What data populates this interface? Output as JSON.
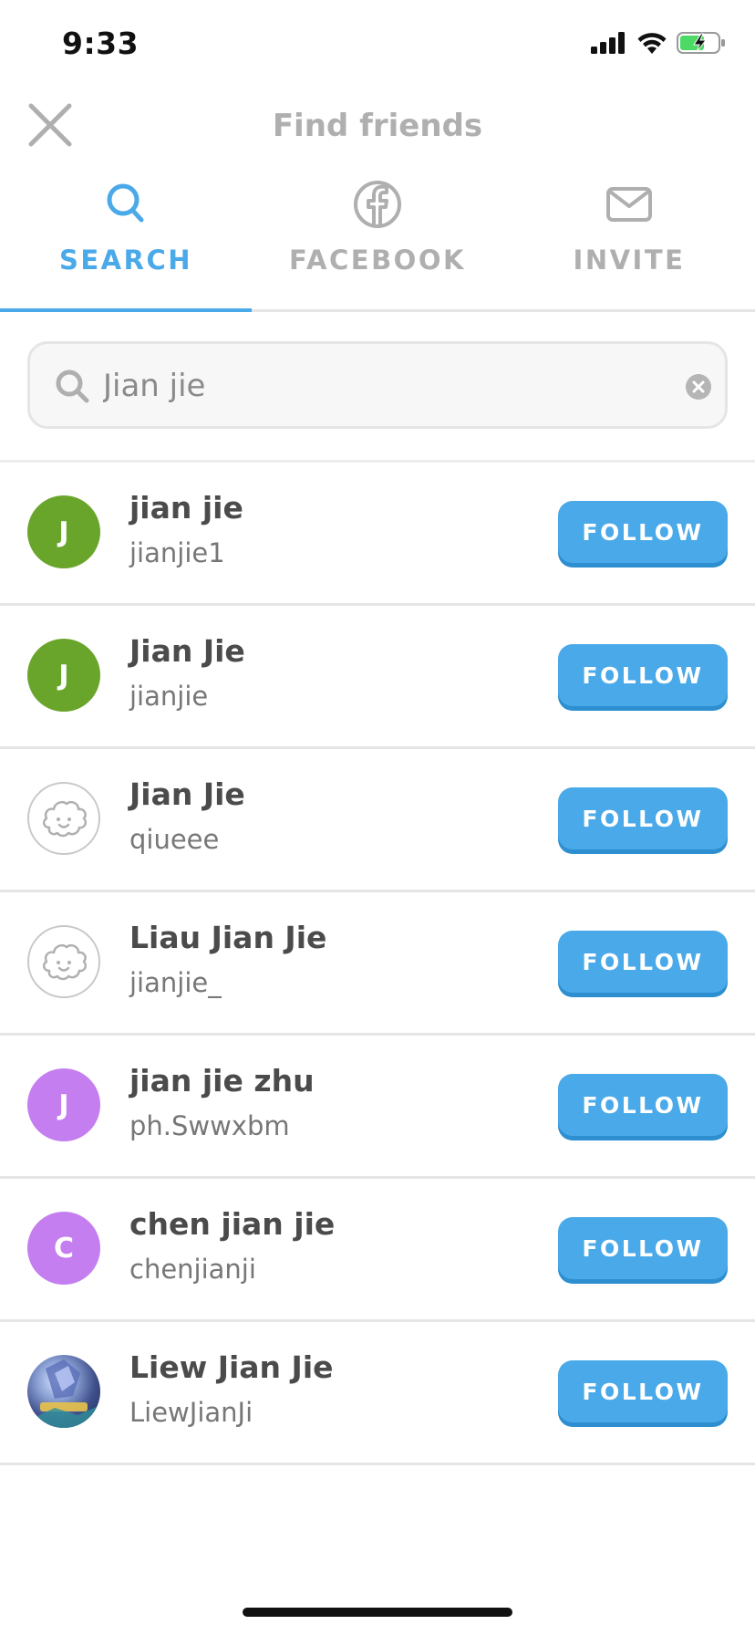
{
  "status_bar": {
    "time": "9:33"
  },
  "header": {
    "title": "Find friends"
  },
  "tabs": [
    {
      "label": "SEARCH",
      "icon": "search-icon",
      "active": true
    },
    {
      "label": "FACEBOOK",
      "icon": "facebook-icon",
      "active": false
    },
    {
      "label": "INVITE",
      "icon": "mail-icon",
      "active": false
    }
  ],
  "search": {
    "value": "Jian jie",
    "placeholder": ""
  },
  "results": [
    {
      "name": "jian jie",
      "username": "jianjie1",
      "avatar_letter": "J",
      "avatar_color": "#6aa52b",
      "avatar_type": "letter",
      "action_label": "FOLLOW"
    },
    {
      "name": "Jian Jie",
      "username": "jianjie",
      "avatar_letter": "J",
      "avatar_color": "#6aa52b",
      "avatar_type": "letter",
      "action_label": "FOLLOW"
    },
    {
      "name": "Jian Jie",
      "username": "qiueee",
      "avatar_letter": "",
      "avatar_color": "#ffffff",
      "avatar_type": "placeholder",
      "action_label": "FOLLOW"
    },
    {
      "name": "Liau Jian Jie",
      "username": "jianjie_",
      "avatar_letter": "",
      "avatar_color": "#ffffff",
      "avatar_type": "placeholder",
      "action_label": "FOLLOW"
    },
    {
      "name": "jian jie zhu",
      "username": "ph.Swwxbm",
      "avatar_letter": "J",
      "avatar_color": "#c47ef0",
      "avatar_type": "letter",
      "action_label": "FOLLOW"
    },
    {
      "name": "chen jian jie",
      "username": "chenjianji",
      "avatar_letter": "C",
      "avatar_color": "#c47ef0",
      "avatar_type": "letter",
      "action_label": "FOLLOW"
    },
    {
      "name": "Liew Jian Jie",
      "username": "LiewJianJi",
      "avatar_letter": "",
      "avatar_color": "#3f4f8a",
      "avatar_type": "photo",
      "action_label": "FOLLOW"
    }
  ],
  "colors": {
    "accent": "#4aa9e8",
    "inactive": "#afafaf",
    "text": "#4b4b4b"
  }
}
